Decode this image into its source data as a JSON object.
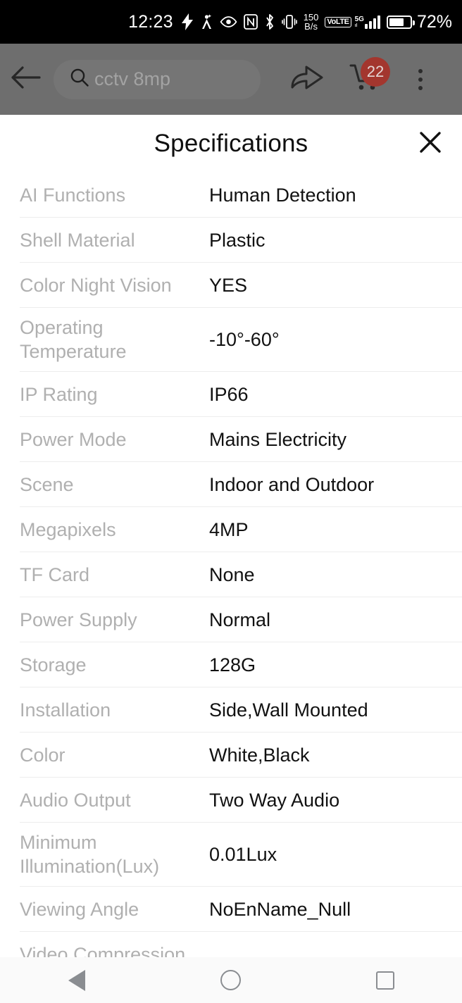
{
  "status_bar": {
    "time": "12:23",
    "icons": [
      "flash-icon",
      "location-icon",
      "eye-icon",
      "nfc-icon",
      "bluetooth-icon",
      "vibrate-icon"
    ],
    "data_rate_value": "150",
    "data_rate_unit": "B/s",
    "volte_label": "VoLTE",
    "network_label": "5G",
    "battery_percent": "72%",
    "battery_level": 72,
    "background_color": "#000000"
  },
  "toolbar": {
    "back_icon": "arrow-left-icon",
    "search_placeholder": "cctv 8mp",
    "search_icon": "search-icon",
    "share_icon": "share-icon",
    "cart_icon": "cart-icon",
    "cart_badge_count": "22",
    "cart_badge_color": "#a3362e",
    "overflow_icon": "more-vertical-icon",
    "background_color": "#6e6e6e"
  },
  "sheet": {
    "title": "Specifications",
    "close_icon": "close-icon",
    "key_color": "#b0b0b0",
    "value_color": "#111111",
    "specs": [
      {
        "key": "AI Functions",
        "value": "Human Detection",
        "tall": false
      },
      {
        "key": "Shell Material",
        "value": "Plastic",
        "tall": false
      },
      {
        "key": "Color Night Vision",
        "value": "YES",
        "tall": false
      },
      {
        "key": "Operating Temperature",
        "value": "-10°-60°",
        "tall": true
      },
      {
        "key": "IP Rating",
        "value": "IP66",
        "tall": false
      },
      {
        "key": "Power Mode",
        "value": "Mains Electricity",
        "tall": false
      },
      {
        "key": "Scene",
        "value": "Indoor and Outdoor",
        "tall": false
      },
      {
        "key": "Megapixels",
        "value": "4MP",
        "tall": false
      },
      {
        "key": "TF Card",
        "value": "None",
        "tall": false
      },
      {
        "key": "Power Supply",
        "value": "Normal",
        "tall": false
      },
      {
        "key": "Storage",
        "value": "128G",
        "tall": false
      },
      {
        "key": "Installation",
        "value": "Side,Wall Mounted",
        "tall": false
      },
      {
        "key": "Color",
        "value": "White,Black",
        "tall": false
      },
      {
        "key": "Audio Output",
        "value": "Two Way Audio",
        "tall": false
      },
      {
        "key": "Minimum Illumination(Lux)",
        "value": "0.01Lux",
        "tall": true
      },
      {
        "key": "Viewing Angle",
        "value": "NoEnName_Null",
        "tall": false
      },
      {
        "key": "Video Compression",
        "value": "",
        "tall": false
      }
    ]
  },
  "nav_bar": {
    "back_label": "back-nav",
    "home_label": "home-nav",
    "recents_label": "recents-nav",
    "background_color": "#fafafa"
  }
}
